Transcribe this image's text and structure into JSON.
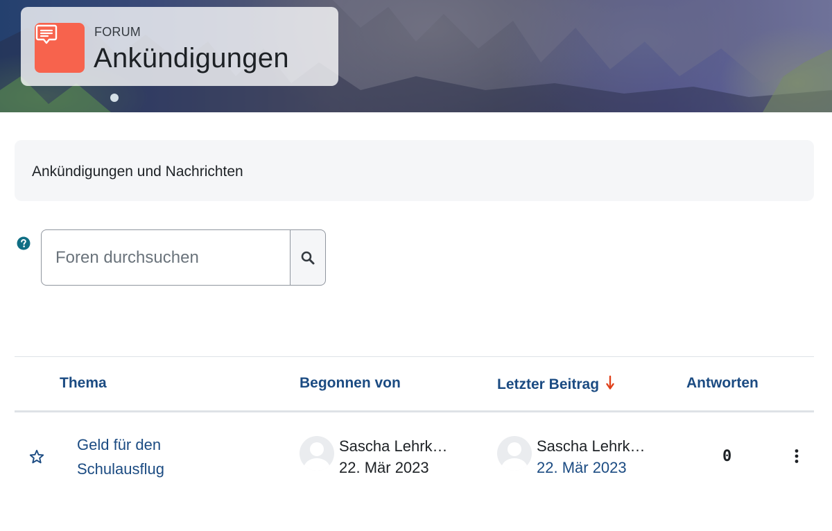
{
  "header": {
    "type_label": "FORUM",
    "title": "Ankündigungen",
    "icon": "forum-icon",
    "icon_color": "#f7634d"
  },
  "intro": {
    "text": "Ankündigungen und Nachrichten"
  },
  "search": {
    "placeholder": "Foren durchsuchen",
    "value": "",
    "help_icon": "question-circle-icon",
    "button_icon": "search-icon"
  },
  "table": {
    "columns": {
      "topic": "Thema",
      "started_by": "Begonnen von",
      "last_post": "Letzter Beitrag",
      "replies": "Antworten"
    },
    "sort_icon": "arrow-down-icon",
    "rows": [
      {
        "topic": "Geld für den Schulausflug",
        "started_by_name": "Sascha Lehrk…",
        "started_date": "22. Mär 2023",
        "last_post_name": "Sascha Lehrk…",
        "last_post_date": "22. Mär 2023",
        "replies": "0"
      }
    ]
  },
  "colors": {
    "link": "#1b4b82",
    "sort_arrow": "#e0401a",
    "help": "#0f6e84"
  }
}
